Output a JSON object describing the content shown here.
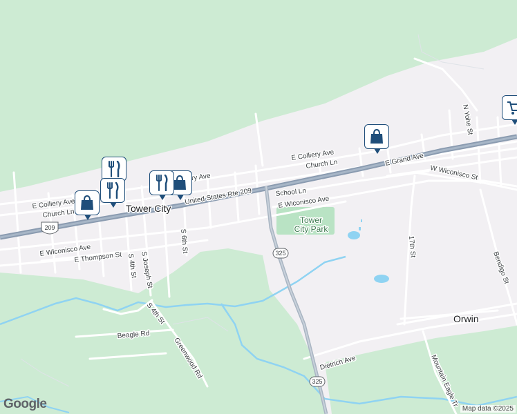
{
  "map": {
    "place_labels": {
      "tower_city": "Tower City",
      "orwin": "Orwin",
      "tower_city_park": [
        "Tower",
        "City Park"
      ]
    },
    "street_labels": {
      "e_colliery_ave_left": "E Colliery Ave",
      "church_ln_left": "Church Ln",
      "ery_ave": "ery Ave",
      "us_rte_209": "United States Rte 209",
      "e_wiconisco_ave_left": "E Wiconisco Ave",
      "e_thompson_st": "E Thompson St",
      "s_4th_st_a": "S 4th St",
      "s_joseph_st": "S Joseph St",
      "s_6th_st": "S 6th St",
      "s_4th_st_b": "S 4th St",
      "greenwood_rd": "Greenwood Rd",
      "beagle_rd": "Beagle Rd",
      "e_colliery_ave_right": "E Colliery Ave",
      "church_ln_right": "Church Ln",
      "school_ln": "School Ln",
      "e_wiconisco_ave_right": "E Wiconisco Ave",
      "e_grand_ave": "E Grand Ave",
      "w_wiconisco_st": "W Wiconisco St",
      "n_yohe_st": "N Yohe St",
      "seventeenth_st": "17th St",
      "bendigo_st": "Bendigo St",
      "dietrich_ave": "Dietrich Ave",
      "mountain_eagle_tr": "Mountain Eagle Tr"
    },
    "shields": {
      "us_209": "209",
      "pa_325_north": "325",
      "pa_325_south": "325"
    },
    "pins": [
      {
        "kind": "restaurant",
        "icon": "fork-knife-icon"
      },
      {
        "kind": "restaurant",
        "icon": "fork-knife-icon"
      },
      {
        "kind": "shopping",
        "icon": "shopping-bag-icon"
      },
      {
        "kind": "restaurant",
        "icon": "fork-knife-icon"
      },
      {
        "kind": "shopping",
        "icon": "shopping-bag-icon"
      },
      {
        "kind": "shopping",
        "icon": "shopping-bag-icon"
      },
      {
        "kind": "grocery",
        "icon": "shopping-cart-icon"
      }
    ],
    "colors": {
      "forest": "#cdebd3",
      "developed": "#f2f0f3",
      "highway": "#8a9bb0",
      "road": "#ffffff",
      "water": "#8fd3f2",
      "pin_border": "#1f4e7a"
    }
  },
  "footer": {
    "logo": "Google",
    "attribution": "Map data ©2025"
  }
}
